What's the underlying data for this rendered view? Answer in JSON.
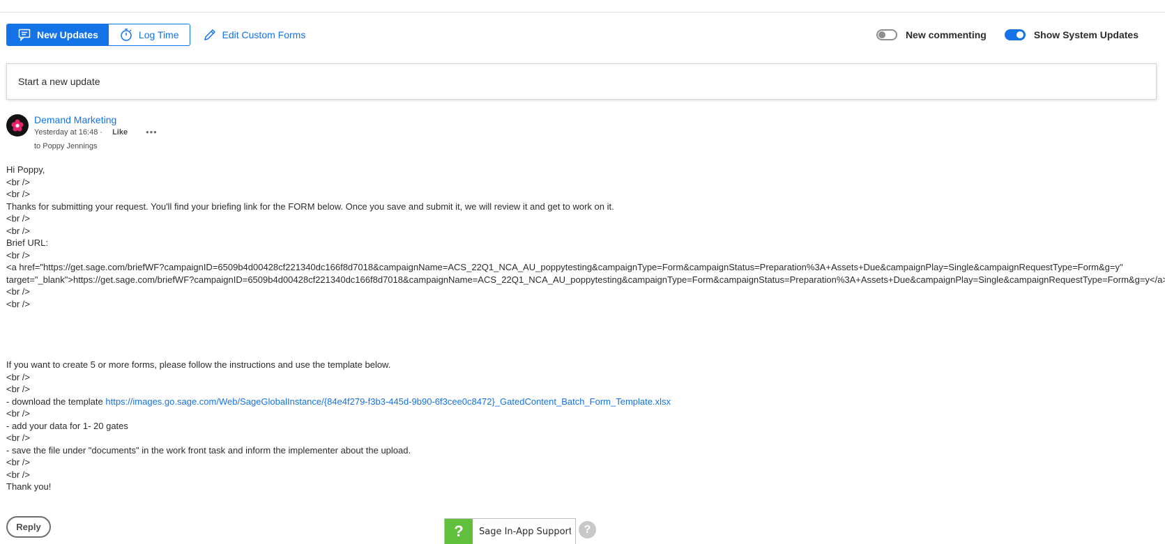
{
  "toolbar": {
    "new_updates_label": "New Updates",
    "log_time_label": "Log Time",
    "edit_custom_forms_label": "Edit Custom Forms",
    "accent_color": "#1473e6"
  },
  "toggles": {
    "new_commenting": {
      "label": "New commenting",
      "state": "off"
    },
    "show_system_updates": {
      "label": "Show System Updates",
      "state": "on"
    }
  },
  "update_box": {
    "placeholder": "Start a new update"
  },
  "post": {
    "author": "Demand Marketing",
    "timestamp": "Yesterday at 16:48 ·",
    "like_label": "Like",
    "more_label": "•••",
    "recipient": "to Poppy Jennings",
    "body": {
      "l1": "Hi Poppy,",
      "l2": "<br />",
      "l3": "<br />",
      "l4": "Thanks for submitting your request. You'll find your briefing link for the FORM below. Once you save and submit it, we will review it and get to work on it.",
      "l5": "<br />",
      "l6": "<br />",
      "l7": "Brief URL:",
      "l8": "<br />",
      "l9": "<a href=\"https://get.sage.com/briefWF?campaignID=6509b4d00428cf221340dc166f8d7018&campaignName=ACS_22Q1_NCA_AU_poppytesting&campaignType=Form&campaignStatus=Preparation%3A+Assets+Due&campaignPlay=Single&campaignRequestType=Form&g=y\"",
      "l10": "target=\"_blank\">https://get.sage.com/briefWF?campaignID=6509b4d00428cf221340dc166f8d7018&campaignName=ACS_22Q1_NCA_AU_poppytesting&campaignType=Form&campaignStatus=Preparation%3A+Assets+Due&campaignPlay=Single&campaignRequestType=Form&g=y</a>",
      "l11": "<br />",
      "l12": "<br />",
      "l13": "If you want to create 5 or more forms, please follow the instructions and use the template below.",
      "l14": "<br />",
      "l15": "<br />",
      "l16_prefix": "- download the template ",
      "l16_link": "https://images.go.sage.com/Web/SageGlobalInstance/{84e4f279-f3b3-445d-9b90-6f3cee0c8472}_GatedContent_Batch_Form_Template.xlsx",
      "l17": "<br />",
      "l18": "- add your data for 1- 20 gates",
      "l19": "<br />",
      "l20": "- save the file under \"documents\" in the work front task and inform the implementer about the upload.",
      "l21": "<br />",
      "l22": "<br />",
      "l23": "Thank you!"
    },
    "reply_label": "Reply"
  },
  "support_widget": {
    "label": "Sage In-App Support",
    "accent_color": "#61c03b",
    "q_glyph": "?",
    "help_glyph": "?"
  }
}
